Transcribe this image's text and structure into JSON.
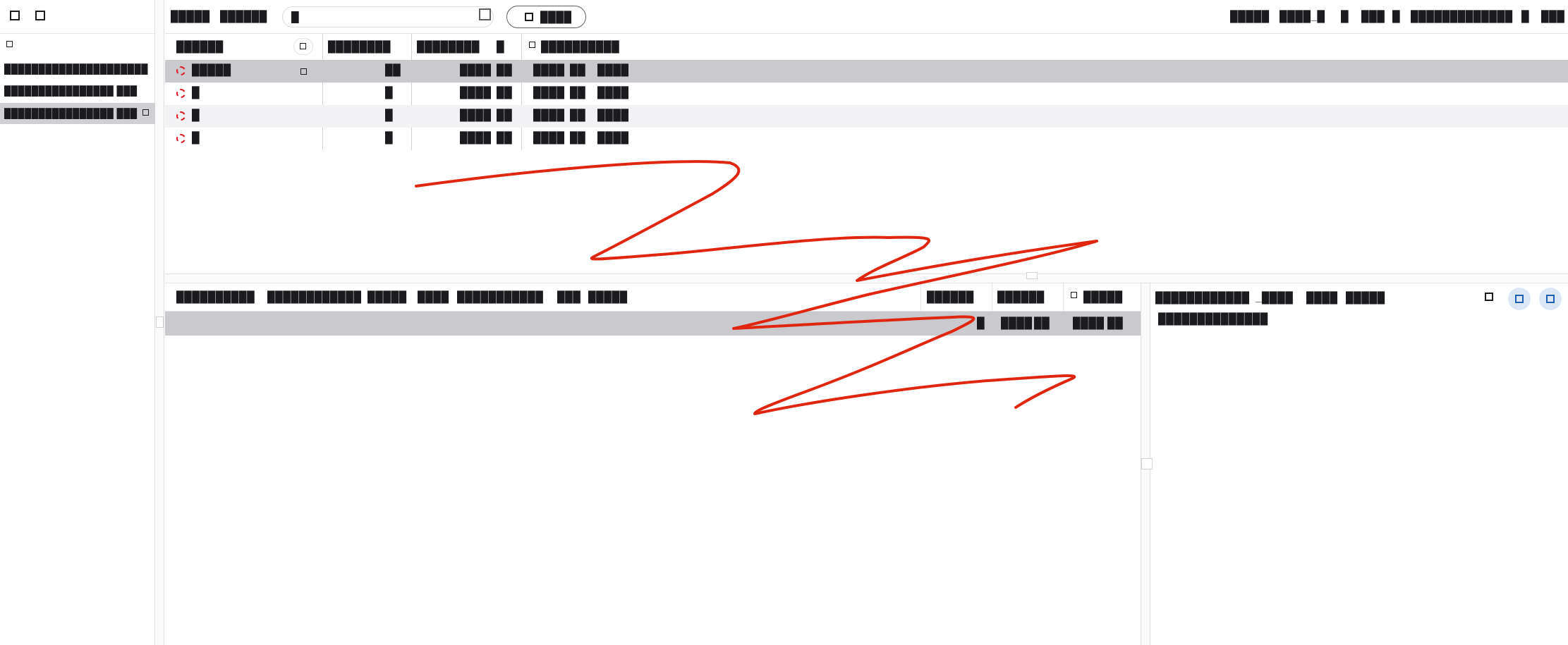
{
  "sidebar": {
    "top_icons": [
      "square-icon",
      "square-icon"
    ],
    "header_icon": "square-icon",
    "items": [
      {
        "label": "█████████████████████"
      },
      {
        "label": "████████████████ ███"
      },
      {
        "label": "████████████████ ███"
      }
    ]
  },
  "toolbar": {
    "menu_1": "█████",
    "menu_2": "██████",
    "search_value": "█",
    "go_label": "████",
    "right_items": [
      "█████",
      "████_█",
      "█",
      "███",
      "█",
      "█████████████",
      "█",
      "███"
    ]
  },
  "upper_table": {
    "columns": [
      "██████",
      "████████",
      "████████",
      "█",
      "██████████"
    ],
    "rows": [
      {
        "name": "█████",
        "c2": "██",
        "c3a": "████",
        "c3b": "██",
        "c4a": "████",
        "c4b": "██",
        "c4c": "████"
      },
      {
        "name": "█",
        "c2": "█",
        "c3a": "████",
        "c3b": "██",
        "c4a": "████",
        "c4b": "██",
        "c4c": "████"
      },
      {
        "name": "█",
        "c2": "█",
        "c3a": "████",
        "c3b": "██",
        "c4a": "████",
        "c4b": "██",
        "c4c": "████"
      },
      {
        "name": "█",
        "c2": "█",
        "c3a": "████",
        "c3b": "██",
        "c4a": "████",
        "c4b": "██",
        "c4c": "████"
      }
    ]
  },
  "lower_table": {
    "headers": [
      "██████████",
      "████████████",
      "█████",
      "████",
      "███████████",
      "███",
      "█████",
      "██████",
      "██████",
      "█████"
    ],
    "row": {
      "a": "█",
      "b": "████",
      "c": "██",
      "d": "████",
      "e": "██"
    }
  },
  "details": {
    "title_parts": [
      "████████████",
      "_████",
      "████",
      "█████"
    ],
    "subtitle": "██████████████"
  },
  "colors": {
    "accent": "#1a5fb4",
    "error": "#e01b24",
    "selection": "#c9c9ce",
    "scribble": "#e0260f"
  }
}
